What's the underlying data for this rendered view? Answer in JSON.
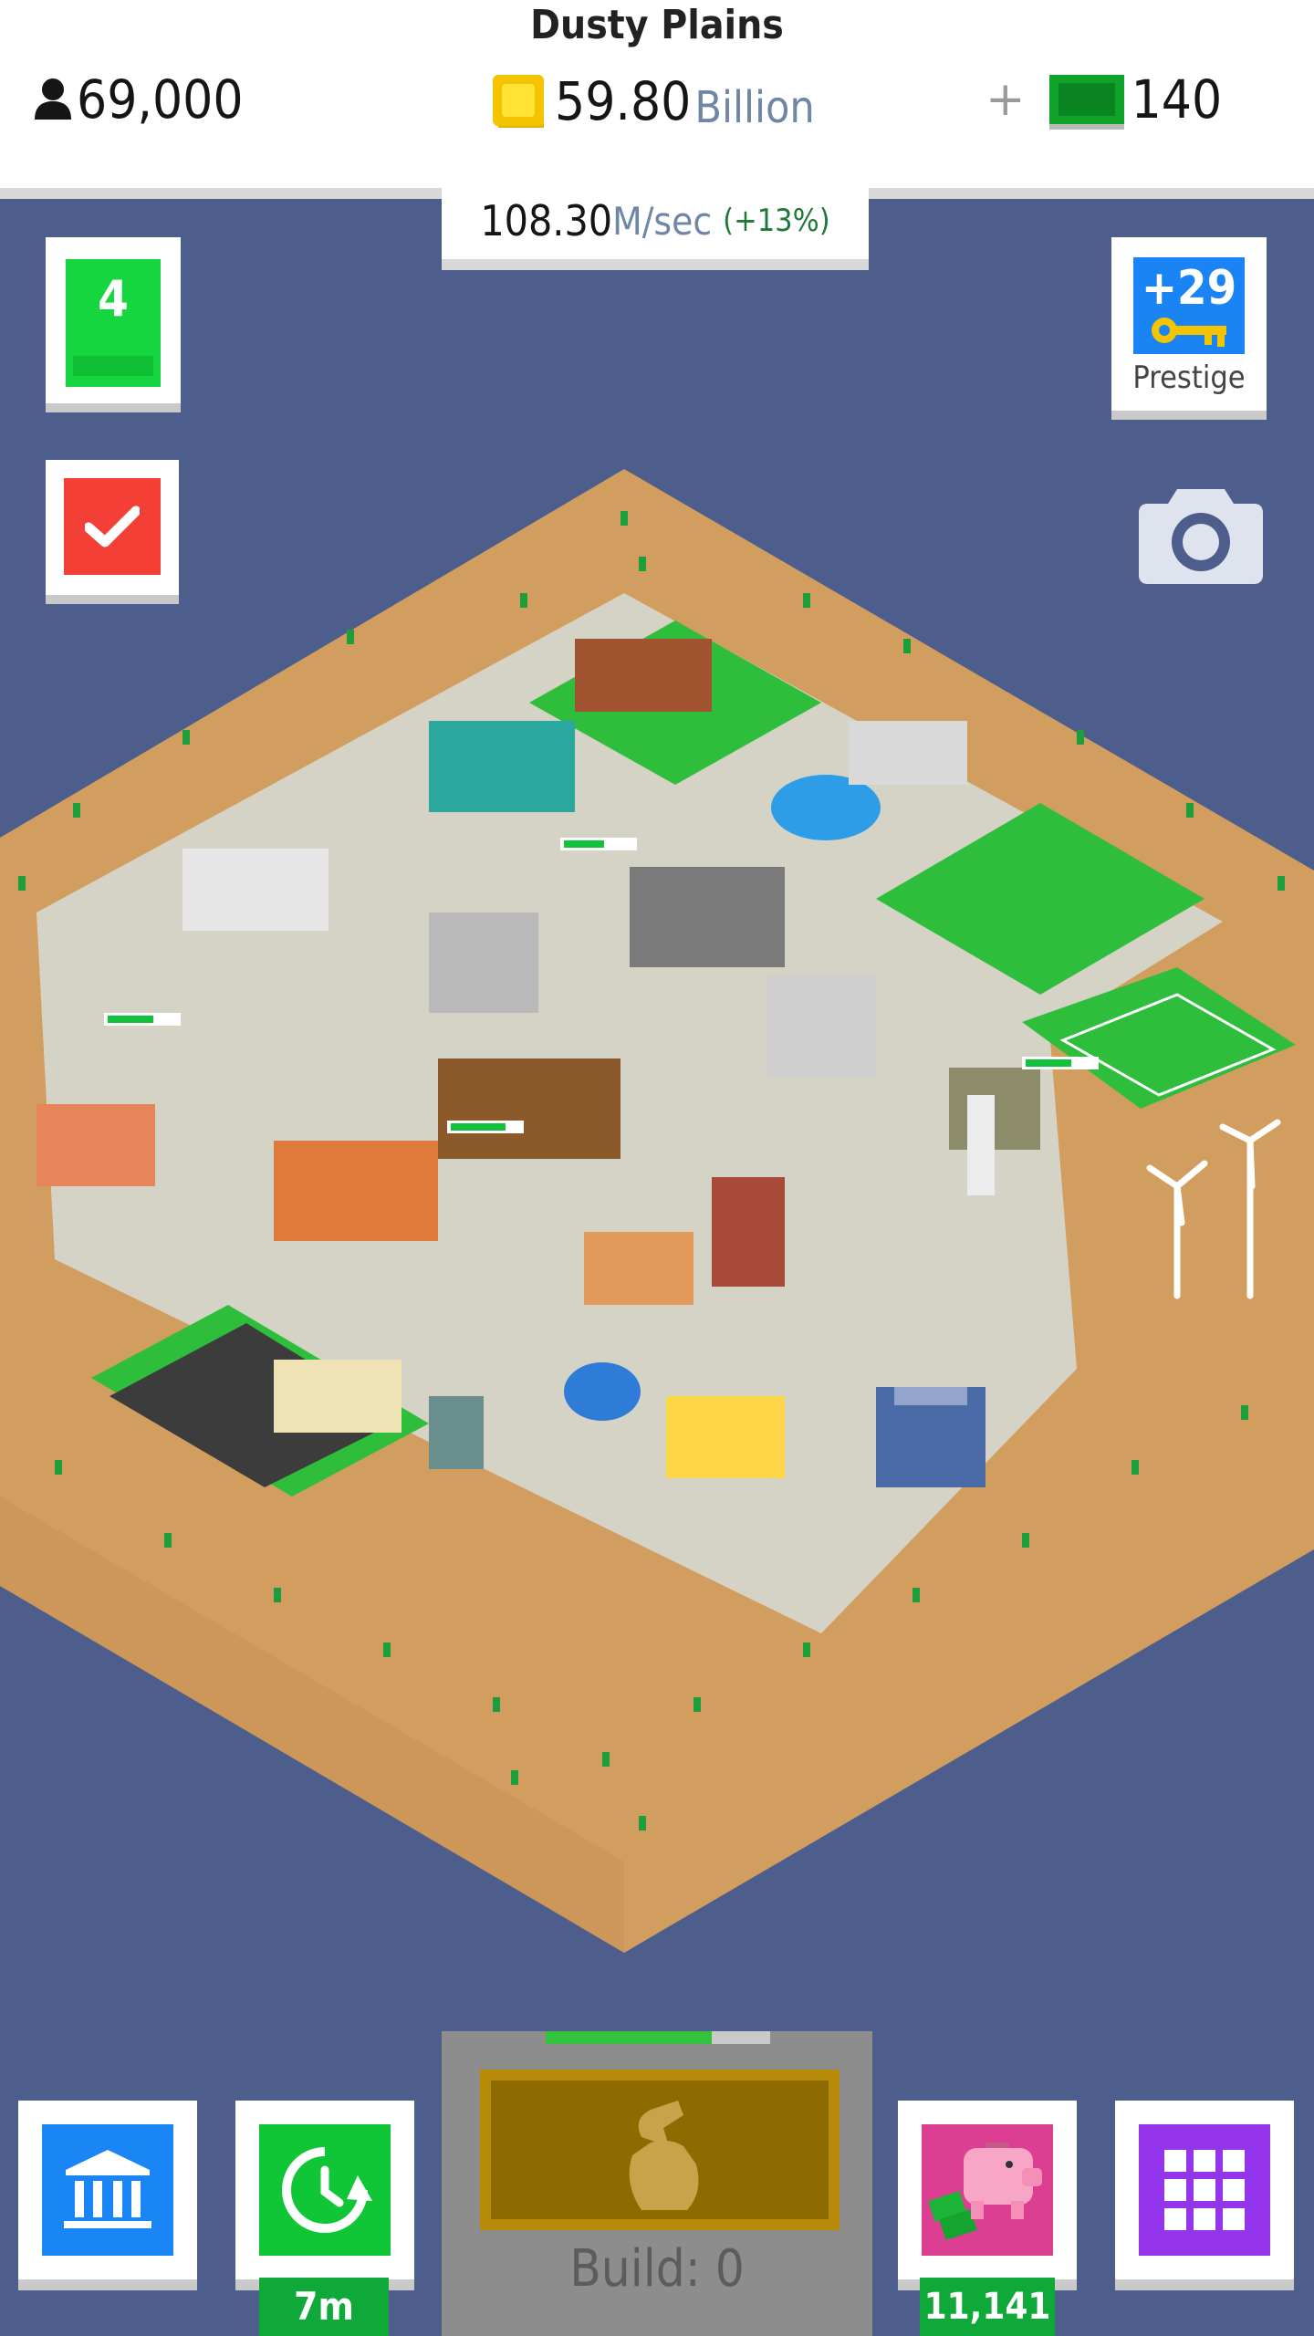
{
  "header": {
    "city_name": "Dusty Plains",
    "population": "69,000",
    "coins_value": "59.80",
    "coins_unit": "Billion",
    "cash_plus": "+",
    "cash_value": "140"
  },
  "income": {
    "value": "108.30",
    "unit": "M/sec",
    "bonus": "(+13%)"
  },
  "level": {
    "number": "4"
  },
  "prestige": {
    "keys": "+29",
    "label": "Prestige"
  },
  "bottom": {
    "boost_timer": "7m",
    "piggy_amount": "11,141",
    "build_label": "Build: 0",
    "build_progress": 0.74
  },
  "icons": {
    "population": "person-icon",
    "coins": "coin-icon",
    "cash": "cash-icon",
    "tasks": "checkmark-icon",
    "prestige": "key-icon",
    "camera": "camera-icon",
    "bank": "bank-icon",
    "boost": "clock-refresh-icon",
    "build": "hammer-hand-icon",
    "piggy": "piggy-bank-icon",
    "menu": "grid-icon"
  },
  "colors": {
    "background": "#4d5e8c",
    "level": "#15d63f",
    "task": "#f33f36",
    "prestige": "#1b84f4",
    "bank": "#1a86f5",
    "boost": "#11c636",
    "piggy": "#dc3f91",
    "menu": "#9333ea"
  }
}
